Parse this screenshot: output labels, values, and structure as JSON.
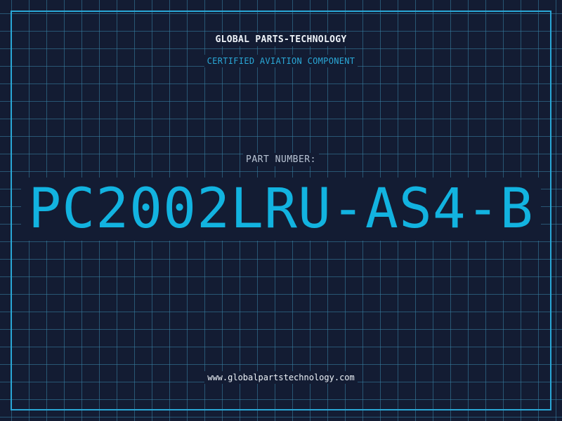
{
  "header": {
    "brand": "GLOBAL PARTS-TECHNOLOGY",
    "tagline": "CERTIFIED AVIATION COMPONENT"
  },
  "part": {
    "label": "PART NUMBER:",
    "number": "PC2002LRU-AS4-B"
  },
  "footer": {
    "website": "www.globalpartstechnology.com"
  },
  "colors": {
    "background": "#131c33",
    "accent": "#2aa7d6",
    "part_number": "#12b3e0",
    "text": "#eef3f8"
  }
}
